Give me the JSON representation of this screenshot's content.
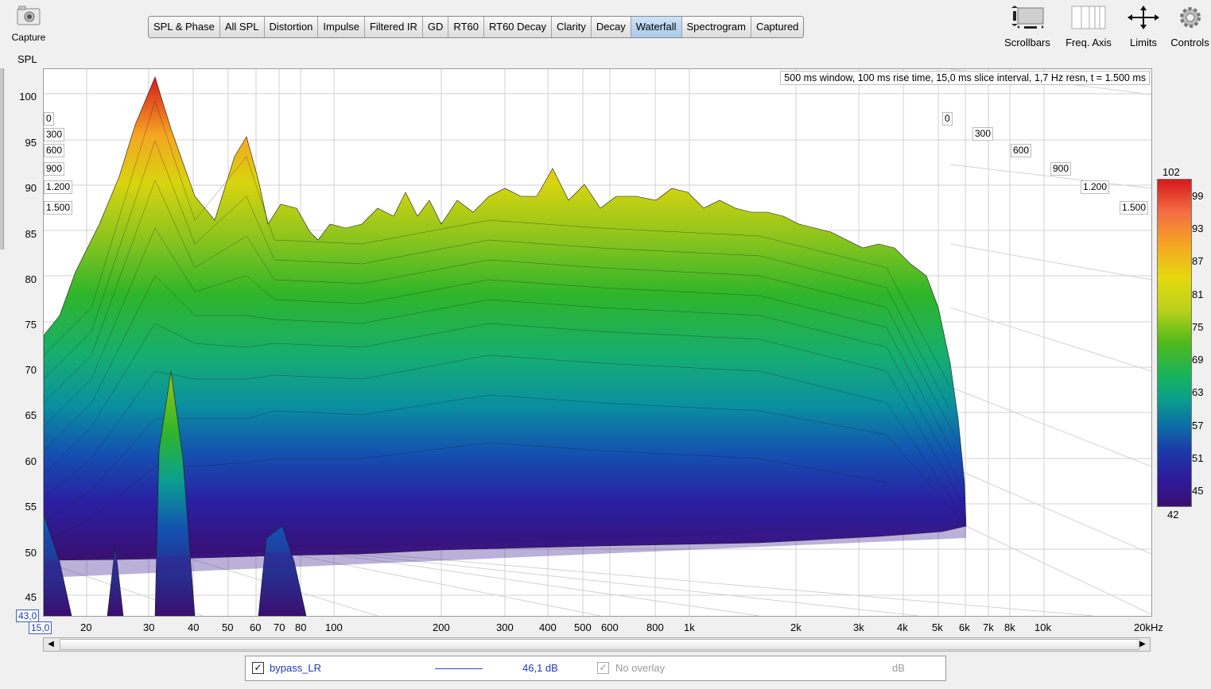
{
  "toolbar": {
    "capture_label": "Capture",
    "tabs": [
      {
        "label": "SPL & Phase"
      },
      {
        "label": "All SPL"
      },
      {
        "label": "Distortion"
      },
      {
        "label": "Impulse"
      },
      {
        "label": "Filtered IR"
      },
      {
        "label": "GD"
      },
      {
        "label": "RT60"
      },
      {
        "label": "RT60 Decay"
      },
      {
        "label": "Clarity"
      },
      {
        "label": "Decay"
      },
      {
        "label": "Waterfall"
      },
      {
        "label": "Spectrogram"
      },
      {
        "label": "Captured"
      }
    ],
    "active_tab": "Waterfall",
    "tools": [
      {
        "label": "Scrollbars",
        "icon": "scrollbars-icon"
      },
      {
        "label": "Freq. Axis",
        "icon": "freq-axis-icon"
      },
      {
        "label": "Limits",
        "icon": "limits-icon"
      },
      {
        "label": "Controls",
        "icon": "gear-icon"
      }
    ]
  },
  "plot": {
    "y_axis_title": "SPL",
    "y_ticks": [
      "100",
      "95",
      "90",
      "85",
      "80",
      "75",
      "70",
      "65",
      "60",
      "55",
      "50",
      "45"
    ],
    "x_ticks": [
      "20",
      "30",
      "40",
      "50",
      "60",
      "70",
      "80",
      "100",
      "200",
      "300",
      "400",
      "500",
      "600",
      "800",
      "1k",
      "2k",
      "3k",
      "4k",
      "5k",
      "6k",
      "7k",
      "8k",
      "10k",
      "20kHz"
    ],
    "y_min_value": "43,0",
    "x_min_value": "15,0",
    "info": "500 ms window, 100 ms rise time, 15,0 ms slice interval, 1,7 Hz resn, t = 1.500 ms",
    "time_ticks_left": [
      "0",
      "300",
      "600",
      "900",
      "1.200",
      "1.500"
    ],
    "time_ticks_right": [
      "0",
      "300",
      "600",
      "900",
      "1.200",
      "1.500"
    ]
  },
  "colorbar": {
    "max": "102",
    "min": "42",
    "ticks": [
      "99",
      "93",
      "87",
      "81",
      "75",
      "69",
      "63",
      "57",
      "51",
      "45"
    ],
    "colors": [
      "#d7191c",
      "#f5a623",
      "#e6d80e",
      "#4fb81b",
      "#0aa18a",
      "#1b3aa8",
      "#3b0f6e"
    ]
  },
  "legend": {
    "trace_name": "bypass_LR",
    "trace_color": "#2a4fd6",
    "trace_value": "46,1 dB",
    "overlay_label": "No overlay",
    "overlay_unit": "dB"
  }
}
